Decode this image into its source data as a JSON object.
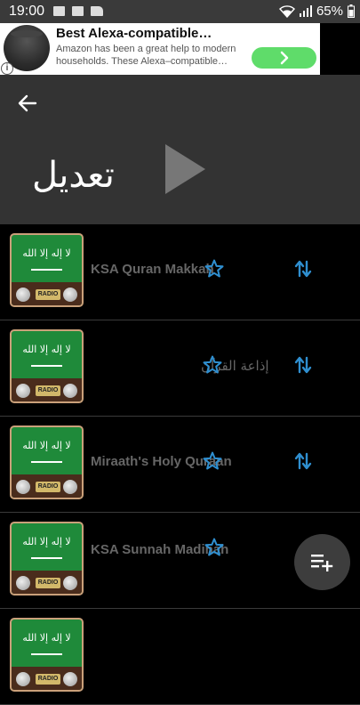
{
  "status_bar": {
    "time": "19:00",
    "battery": "65%"
  },
  "ad": {
    "title": "Best Alexa-compatible…",
    "body_line1": "Amazon has been a great help to modern",
    "body_line2": "households. These Alexa–compatible…",
    "info_glyph": "i"
  },
  "header": {
    "title": "تعديل"
  },
  "stations": [
    {
      "title": "KSA Quran Makkah",
      "title_dir": "ltr"
    },
    {
      "title": "إذاعة القرآن",
      "title_dir": "rtl"
    },
    {
      "title": "Miraath's Holy Quraan",
      "title_dir": "ltr"
    },
    {
      "title": "KSA Sunnah Madinah",
      "title_dir": "ltr"
    },
    {
      "title": "",
      "title_dir": "ltr"
    }
  ],
  "thumbnail": {
    "calligraphy": "لا إله إلا الله",
    "label": "RADIO"
  },
  "colors": {
    "accent": "#2f8fd0",
    "header_bg": "#333333",
    "fab_bg": "#3d3d3d",
    "ad_cta": "#5fdc6a"
  }
}
